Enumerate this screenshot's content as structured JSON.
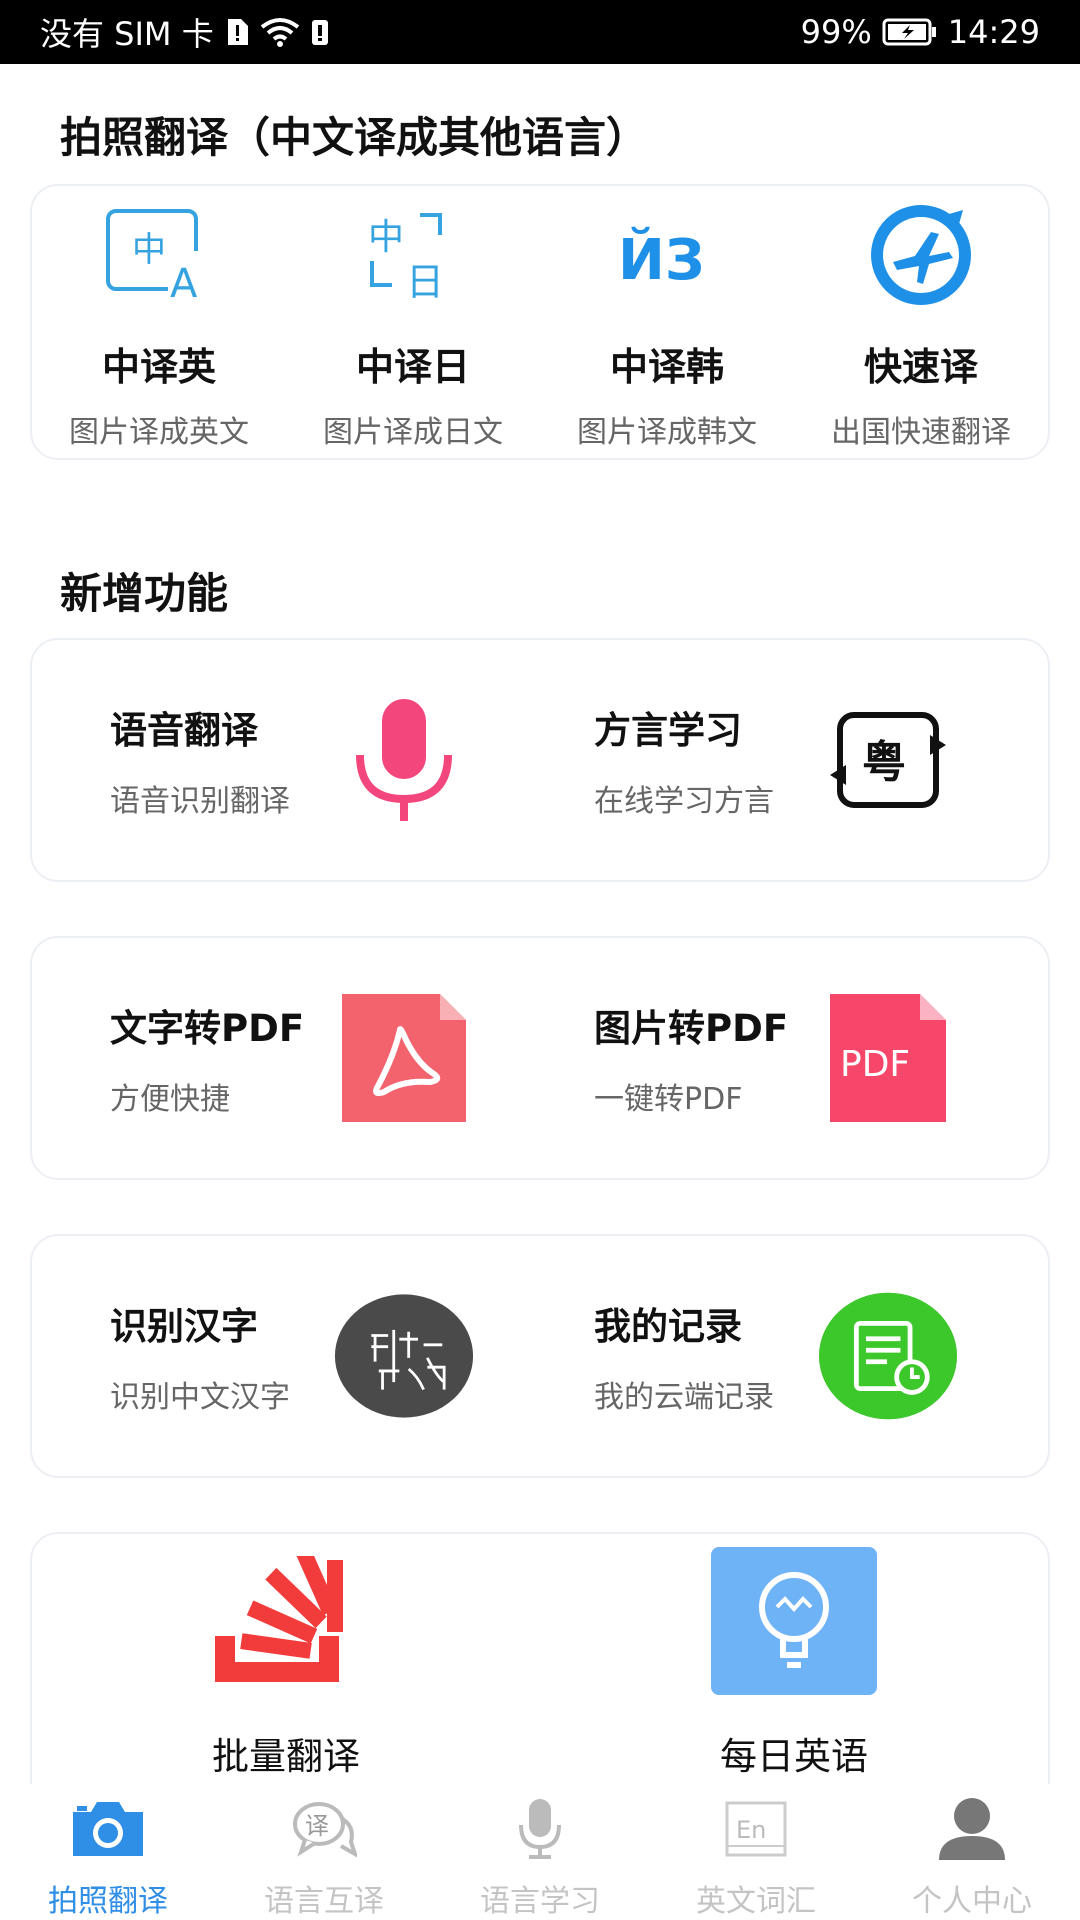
{
  "status_bar": {
    "carrier": "没有 SIM 卡",
    "battery": "99%",
    "time": "14:29"
  },
  "photo_section": {
    "title": "拍照翻译（中文译成其他语言）",
    "items": [
      {
        "label": "中译英",
        "sub": "图片译成英文",
        "icon": "zh-en-icon"
      },
      {
        "label": "中译日",
        "sub": "图片译成日文",
        "icon": "zh-ja-icon"
      },
      {
        "label": "中译韩",
        "sub": "图片译成韩文",
        "icon": "zh-ko-icon"
      },
      {
        "label": "快速译",
        "sub": "出国快速翻译",
        "icon": "airplane-icon"
      }
    ]
  },
  "new_section": {
    "title": "新增功能",
    "rows": [
      [
        {
          "title": "语音翻译",
          "sub": "语音识别翻译",
          "icon": "microphone-icon",
          "color": "#f2467c"
        },
        {
          "title": "方言学习",
          "sub": "在线学习方言",
          "icon": "dialect-icon",
          "glyph": "粤"
        }
      ],
      [
        {
          "title": "文字转PDF",
          "sub": "方便快捷",
          "icon": "acrobat-file-icon",
          "color": "#f2636e"
        },
        {
          "title": "图片转PDF",
          "sub": "一键转PDF",
          "icon": "pdf-file-icon",
          "glyph": "PDF",
          "color": "#f6476a"
        }
      ],
      [
        {
          "title": "识别汉字",
          "sub": "识别中文汉字",
          "icon": "chinese-char-icon",
          "color": "#4a4a4a"
        },
        {
          "title": "我的记录",
          "sub": "我的云端记录",
          "icon": "record-icon",
          "color": "#3cc72a"
        }
      ]
    ]
  },
  "bottom_card": {
    "items": [
      {
        "label": "批量翻译",
        "icon": "stack-icon",
        "color": "#f23c3c"
      },
      {
        "label": "每日英语",
        "icon": "lightbulb-icon",
        "color": "#6fb3f7"
      }
    ]
  },
  "tabs": [
    {
      "label": "拍照翻译",
      "icon": "camera-icon",
      "active": true
    },
    {
      "label": "语言互译",
      "icon": "chat-translate-icon",
      "glyph": "译",
      "active": false
    },
    {
      "label": "语言学习",
      "icon": "microphone-icon",
      "active": false
    },
    {
      "label": "英文词汇",
      "icon": "english-book-icon",
      "glyph": "En",
      "active": false
    },
    {
      "label": "个人中心",
      "icon": "person-icon",
      "active": false
    }
  ],
  "colors": {
    "accent": "#2f8ee6",
    "photo_icon_blue": "#35a3e0",
    "tab_inactive": "#c4c4c4"
  }
}
